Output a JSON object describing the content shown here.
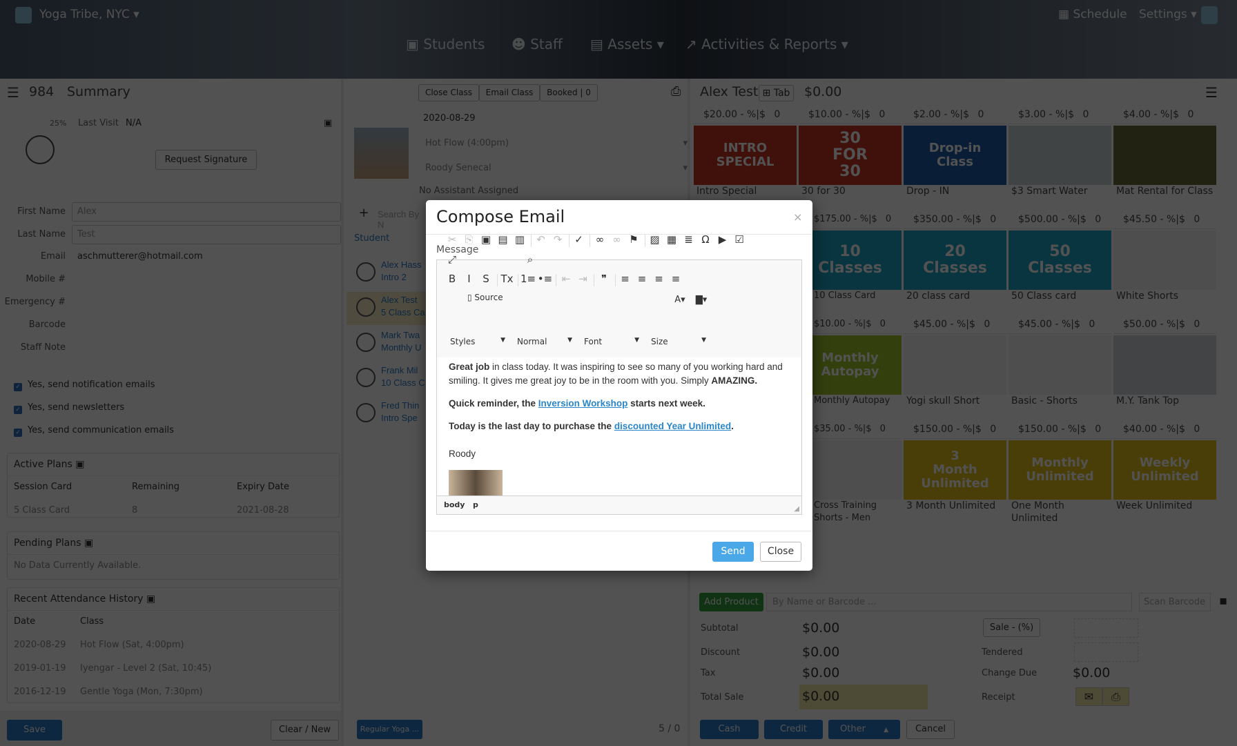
{
  "header": {
    "studio": "Yoga Tribe, NYC",
    "schedule": "Schedule",
    "settings": "Settings",
    "nav": [
      "Students",
      "Staff",
      "Assets",
      "Activities & Reports"
    ]
  },
  "left": {
    "id": "984",
    "title": "Summary",
    "progress": "25%",
    "last_visit_label": "Last Visit",
    "last_visit": "N/A",
    "request_signature": "Request Signature",
    "fields": [
      {
        "label": "First Name",
        "value": "Alex"
      },
      {
        "label": "Last Name",
        "value": "Test"
      },
      {
        "label": "Email",
        "value": "aschmutterer@hotmail.com"
      },
      {
        "label": "Mobile #",
        "value": ""
      },
      {
        "label": "Emergency #",
        "value": ""
      },
      {
        "label": "Barcode",
        "value": ""
      },
      {
        "label": "Staff Note",
        "value": ""
      }
    ],
    "checks": [
      "Yes, send notification emails",
      "Yes, send newsletters",
      "Yes, send communication emails"
    ],
    "active_plans": {
      "title": "Active Plans",
      "headers": [
        "Session Card",
        "Remaining",
        "Expiry Date"
      ],
      "row": [
        "5 Class Card",
        "8",
        "2021-08-28"
      ]
    },
    "pending_plans": {
      "title": "Pending Plans",
      "empty": "No Data Currently Available."
    },
    "attendance": {
      "title": "Recent Attendance History",
      "headers": [
        "Date",
        "Class"
      ],
      "rows": [
        [
          "2020-08-29",
          "Hot Flow (Sat, 4:00pm)"
        ],
        [
          "2019-01-19",
          "Iyengar - Level 2 (Sat, 10:45)"
        ],
        [
          "2016-12-19",
          "Gentle Yoga (Mon, 7:30pm)"
        ]
      ]
    },
    "save": "Save",
    "clear": "Clear / New"
  },
  "middle": {
    "close_class": "Close Class",
    "email_class": "Email Class",
    "booked": "Booked | 0",
    "date": "2020-08-29",
    "class": "Hot Flow (4:00pm)",
    "teacher": "Roody Senecal",
    "assistant": "No Assistant Assigned",
    "search_placeholder": "Search By N",
    "student_header": "Student",
    "students": [
      {
        "name": "Alex Hass",
        "plan": "Intro 2"
      },
      {
        "name": "Alex Test",
        "plan": "5 Class Ca"
      },
      {
        "name": "Mark Twa",
        "plan": "Monthly U"
      },
      {
        "name": "Frank Mil",
        "plan": "10 Class C"
      },
      {
        "name": "Fred Thin",
        "plan": "Intro Spe"
      }
    ],
    "regular": "Regular Yoga ...",
    "count": "5 / 0"
  },
  "right": {
    "client": "Alex Test",
    "tab": "Tab",
    "balance": "$0.00",
    "products": [
      {
        "price": "$20.00",
        "name": "Intro Special",
        "art": "INTRO SPECIAL",
        "color": "#c8321e"
      },
      {
        "price": "$10.00",
        "name": "30 for 30",
        "art": "30 FOR 30",
        "color": "#c8321e"
      },
      {
        "price": "$2.00",
        "name": "Drop - IN",
        "art": "Drop-in Class",
        "color": "#1d5fa8"
      },
      {
        "price": "$3.00",
        "name": "$3 Smart Water",
        "art": "",
        "color": "#c9d6d8"
      },
      {
        "price": "$4.00",
        "name": "Mat Rental for Class",
        "art": "",
        "color": "#6b6b3a"
      },
      {
        "price": "$175.00",
        "name": "10 Class Card",
        "art": "10 Classes",
        "color": "#1aa6c4"
      },
      {
        "price": "$350.00",
        "name": "20 class card",
        "art": "20 Classes",
        "color": "#1aa6c4"
      },
      {
        "price": "$500.00",
        "name": "50 Class card",
        "art": "50 Classes",
        "color": "#1aa6c4"
      },
      {
        "price": "$45.50",
        "name": "White Shorts",
        "art": "",
        "color": "#f3f3f3"
      },
      {
        "price": "$10.00",
        "name": "Monthly Autopay",
        "art": "Monthly Autopay",
        "color": "#9fc42a"
      },
      {
        "price": "$45.00",
        "name": "Yogi skull Short",
        "art": "",
        "color": "#f3f3f3"
      },
      {
        "price": "$45.00",
        "name": "Basic - Shorts",
        "art": "",
        "color": "#f3f3f3"
      },
      {
        "price": "$50.00",
        "name": "M.Y. Tank Top",
        "art": "",
        "color": "#cfd6dc"
      },
      {
        "price": "$35.00",
        "name": "Cross Training Shorts - Men",
        "art": "",
        "color": "#f3f3f3"
      },
      {
        "price": "$150.00",
        "name": "3 Month Unlimited",
        "art": "3 Month Unlimited",
        "color": "#e8c21a"
      },
      {
        "price": "$150.00",
        "name": "One Month Unlimited",
        "art": "Monthly Unlimited",
        "color": "#e8c21a"
      },
      {
        "price": "$40.00",
        "name": "Week Unlimited",
        "art": "Weekly Unlimited",
        "color": "#e8c21a"
      }
    ],
    "discount_label": "- %|$",
    "qty": "0",
    "add_product": "Add Product",
    "search_placeholder": "By Name or Barcode ...",
    "scan_placeholder": "Scan Barcode",
    "subtotal_label": "Subtotal",
    "subtotal": "$0.00",
    "discount_row": "Discount",
    "discount": "$0.00",
    "tax_label": "Tax",
    "tax": "$0.00",
    "total_label": "Total Sale",
    "total": "$0.00",
    "sale_btn": "Sale - (%)",
    "tendered": "Tendered",
    "change_label": "Change Due",
    "change": "$0.00",
    "receipt": "Receipt",
    "cash": "Cash",
    "credit": "Credit",
    "other": "Other",
    "cancel": "Cancel"
  },
  "modal": {
    "title": "Compose Email",
    "close_x": "×",
    "message_label": "Message",
    "source": "Source",
    "styles": "Styles",
    "format": "Normal",
    "font": "Font",
    "size": "Size",
    "body": {
      "p1_bold": "Great job",
      "p1_rest": " in class today. It was inspiring to see so many of you working hard and smiling. It gives me great joy to be in the room with you. Simply ",
      "p1_end": "AMAZING.",
      "p2_pre": "Quick reminder, the ",
      "p2_link": "Inversion Workshop",
      "p2_post": " starts next week.",
      "p3_pre": "Today is the last day to purchase the ",
      "p3_link": "discounted Year Unlimited",
      "p3_post": ".",
      "signature": "Roody"
    },
    "path": [
      "body",
      "p"
    ],
    "send": "Send",
    "close": "Close"
  }
}
